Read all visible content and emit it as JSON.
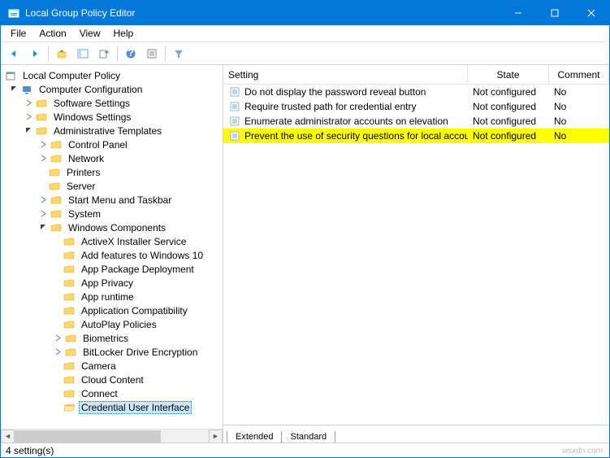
{
  "window": {
    "title": "Local Group Policy Editor"
  },
  "menu": {
    "file": "File",
    "action": "Action",
    "view": "View",
    "help": "Help"
  },
  "tree": {
    "root": "Local Computer Policy",
    "cc": "Computer Configuration",
    "ss": "Software Settings",
    "ws": "Windows Settings",
    "at": "Administrative Templates",
    "cp": "Control Panel",
    "net": "Network",
    "pr": "Printers",
    "srv": "Server",
    "smt": "Start Menu and Taskbar",
    "sys": "System",
    "wc": "Windows Components",
    "ax": "ActiveX Installer Service",
    "af": "Add features to Windows 10",
    "apd": "App Package Deployment",
    "apr": "App Privacy",
    "art": "App runtime",
    "ac": "Application Compatibility",
    "ap": "AutoPlay Policies",
    "bio": "Biometrics",
    "bde": "BitLocker Drive Encryption",
    "cam": "Camera",
    "cld": "Cloud Content",
    "con": "Connect",
    "cui": "Credential User Interface"
  },
  "list": {
    "header": {
      "setting": "Setting",
      "state": "State",
      "comment": "Comment"
    },
    "rows": [
      {
        "setting": "Do not display the password reveal button",
        "state": "Not configured",
        "comment": "No",
        "hl": false
      },
      {
        "setting": "Require trusted path for credential entry",
        "state": "Not configured",
        "comment": "No",
        "hl": false
      },
      {
        "setting": "Enumerate administrator accounts on elevation",
        "state": "Not configured",
        "comment": "No",
        "hl": false
      },
      {
        "setting": "Prevent the use of security questions for local accounts",
        "state": "Not configured",
        "comment": "No",
        "hl": true
      }
    ]
  },
  "tabs": {
    "extended": "Extended",
    "standard": "Standard"
  },
  "status": {
    "text": "4 setting(s)"
  },
  "watermark": "wsxdn.com"
}
